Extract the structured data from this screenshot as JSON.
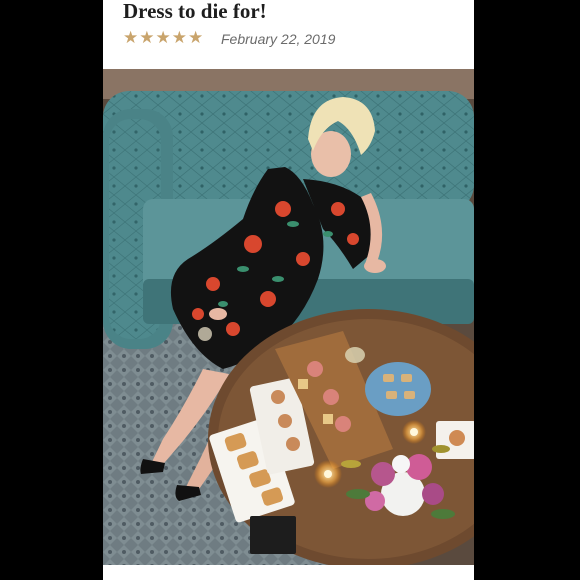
{
  "review": {
    "title": "Dress to die for!",
    "rating": 5,
    "date": "February 22, 2019",
    "star_color": "#c9a46c"
  },
  "photo": {
    "subject": "woman-on-sofa-photo",
    "icon_name": "review-photo"
  }
}
